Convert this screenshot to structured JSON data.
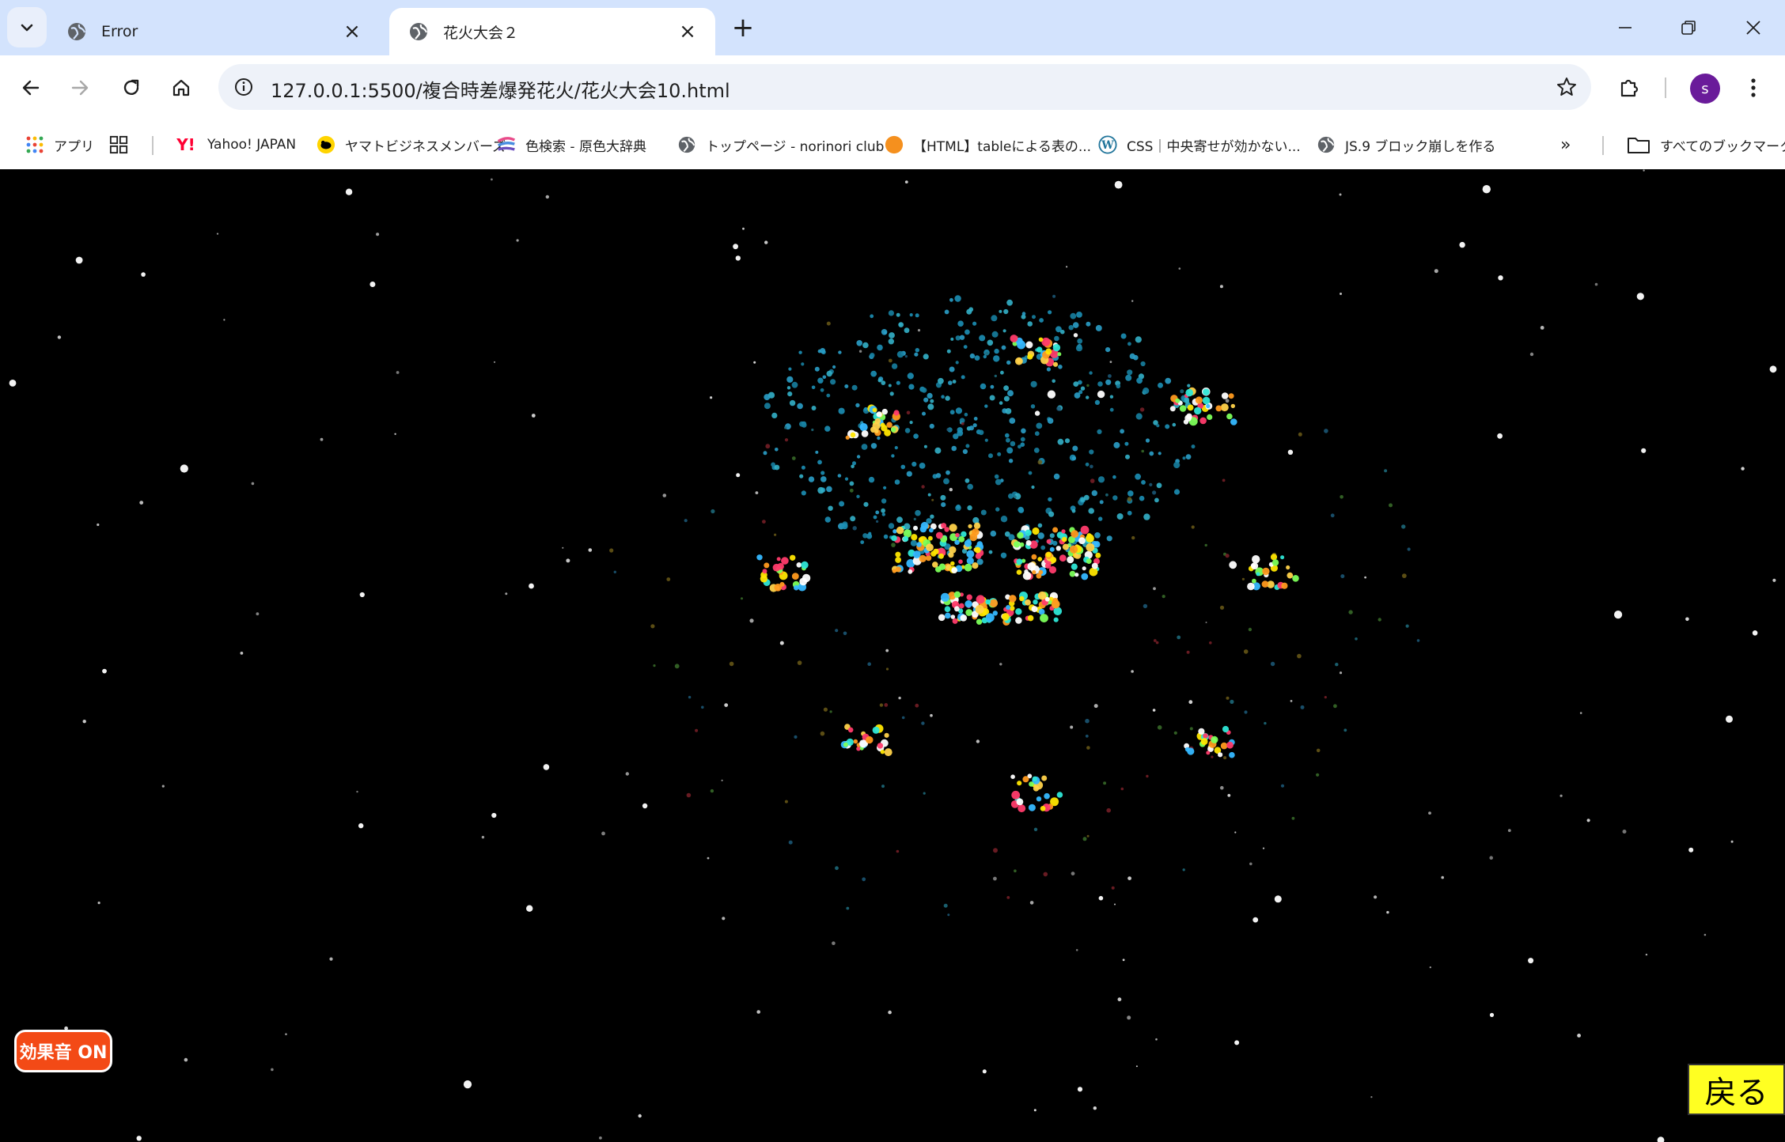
{
  "tabs": [
    {
      "title": "Error",
      "active": false
    },
    {
      "title": "花火大会２",
      "active": true
    }
  ],
  "address_bar": {
    "url": "127.0.0.1:5500/複合時差爆発花火/花火大会10.html"
  },
  "profile": {
    "initial": "s",
    "color": "#6a1b9a"
  },
  "bookmarks": {
    "items": [
      {
        "label": "アプリ",
        "icon": "apps-grid-icon"
      },
      {
        "label": "",
        "icon": "tab-groups-icon"
      },
      {
        "label": "Yahoo! JAPAN",
        "icon": "yahoo-icon"
      },
      {
        "label": "ヤマトビジネスメンバーズ",
        "icon": "yamato-icon"
      },
      {
        "label": "色検索 - 原色大辞典",
        "icon": "color-icon"
      },
      {
        "label": "トップページ - norinori club",
        "icon": "globe-icon"
      },
      {
        "label": "【HTML】tableによる表の...",
        "icon": "orange-circle-icon"
      },
      {
        "label": "CSS｜中央寄せが効かない...",
        "icon": "wordpress-icon"
      },
      {
        "label": "JS.9 ブロック崩しを作る",
        "icon": "globe-icon"
      }
    ],
    "all_bookmarks_label": "すべてのブックマーク"
  },
  "page": {
    "sound_toggle_label": "効果音 ON",
    "back_button_label": "戻る",
    "background": "#000000",
    "colors": {
      "sound_button": "#f34a16",
      "back_button": "#ffff22"
    }
  }
}
